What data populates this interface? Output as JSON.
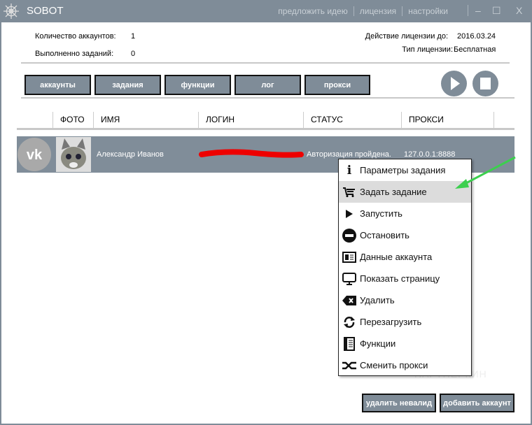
{
  "window": {
    "title": "SOBOT",
    "links": [
      "предложить идею",
      "лицензия",
      "настройки"
    ],
    "minimize": "‒",
    "maximize": "☐",
    "close": "X"
  },
  "stats": {
    "accounts_label": "Количество аккаунтов:",
    "accounts_value": "1",
    "tasks_label": "Выполненно заданий:",
    "tasks_value": "0",
    "license_until_label": "Действие лицензии до:",
    "license_until_value": "2016.03.24",
    "license_type_label": "Тип лицензии:",
    "license_type_value": "Бесплатная"
  },
  "tabs": [
    "аккаунты",
    "задания",
    "функции",
    "лог",
    "прокси"
  ],
  "table": {
    "headers": [
      "ФОТО",
      "ИМЯ",
      "ЛОГИН",
      "СТАТУС",
      "ПРОКСИ"
    ],
    "rows": [
      {
        "name": "Александр Иванов",
        "status": "Авторизация пройдена.",
        "proxy": "127.0.0.1:8888"
      }
    ]
  },
  "context_menu": {
    "items": [
      {
        "label": "Параметры задания",
        "icon": "info-icon"
      },
      {
        "label": "Задать задание",
        "icon": "cart-icon",
        "highlighted": true
      },
      {
        "label": "Запустить",
        "icon": "play-icon"
      },
      {
        "label": "Остановить",
        "icon": "stop-sign-icon"
      },
      {
        "label": "Данные аккаунта",
        "icon": "id-card-icon"
      },
      {
        "label": "Показать страницу",
        "icon": "monitor-icon"
      },
      {
        "label": "Удалить",
        "icon": "backspace-icon"
      },
      {
        "label": "Перезагрузить",
        "icon": "refresh-icon"
      },
      {
        "label": "Функции",
        "icon": "list-icon"
      },
      {
        "label": "Сменить прокси",
        "icon": "shuffle-icon"
      }
    ]
  },
  "buttons": {
    "delete_invalid": "удалить невалид",
    "add_account": "добавить аккаунт"
  },
  "watermark": "ПАРТНЕРКИН",
  "colors": {
    "accent": "#7f8c98",
    "highlight": "#dcdcdc",
    "arrow": "#3ccf4e"
  }
}
